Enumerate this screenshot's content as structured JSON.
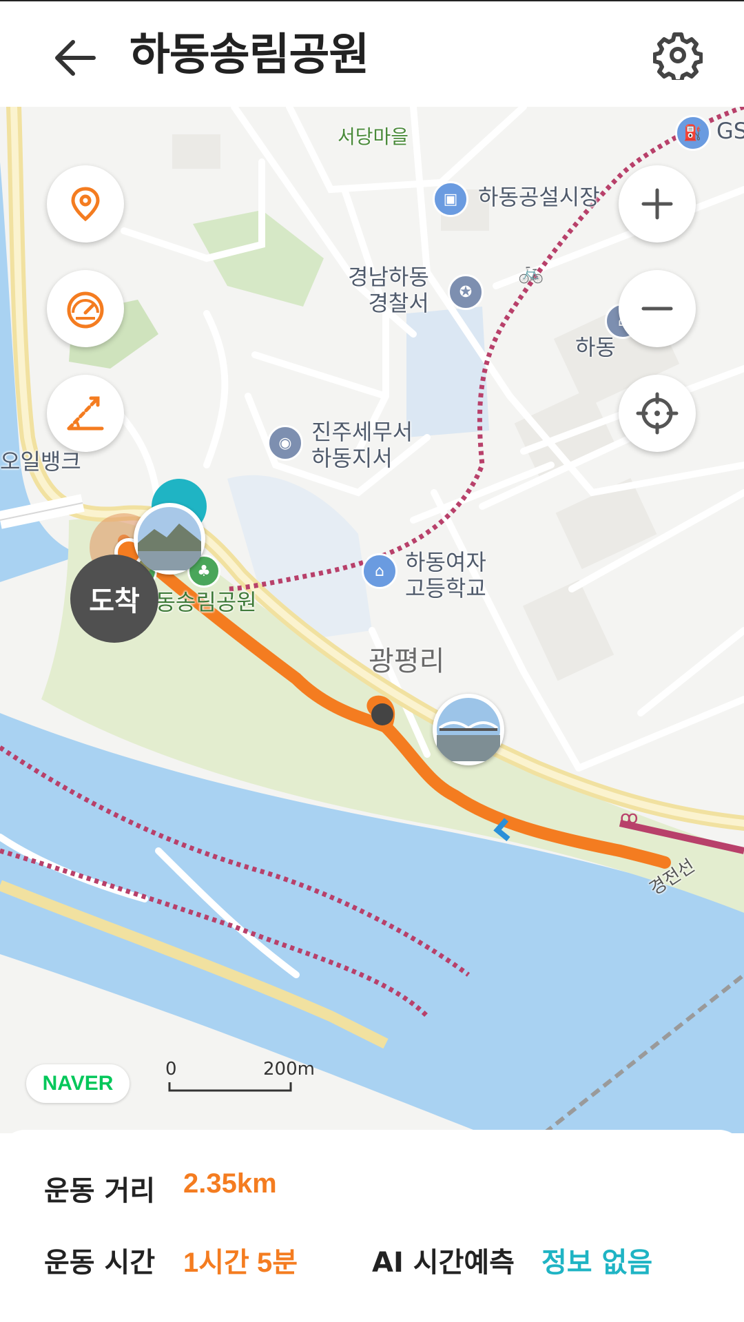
{
  "header": {
    "title": "하동송림공원",
    "back_icon": "arrow-left-icon",
    "settings_icon": "gear-icon"
  },
  "map": {
    "labels": {
      "seodang": "서당마을",
      "market": "하동공설시장",
      "police": "경남하동\n경찰서",
      "tax_office": "진주세무서\n하동지서",
      "girls_school": "하동여자\n고등학교",
      "gwangpyeong": "광평리",
      "park": "하동송림공원",
      "gs": "GS",
      "hadong_partial": "하동",
      "oilbank_partial": "오일뱅크",
      "railway": "경전선"
    },
    "arrive_label": "도착",
    "scale": {
      "start": "0",
      "end": "200m"
    },
    "provider": "NAVER",
    "route_color": "#f47c20",
    "bike_path_color": "#b8406a"
  },
  "controls": {
    "location_pin_icon": "location-pin-icon",
    "speedometer_icon": "speedometer-icon",
    "slope_icon": "slope-icon",
    "zoom_in_icon": "plus-icon",
    "zoom_out_icon": "minus-icon",
    "my_location_icon": "crosshair-icon"
  },
  "stats": {
    "distance_label": "운동 거리",
    "distance_value": "2.35km",
    "time_label": "운동 시간",
    "time_value": "1시간 5분",
    "ai_label": "AI 시간예측",
    "ai_value": "정보 없음"
  },
  "colors": {
    "accent_orange": "#f47c20",
    "teal": "#1fb4c4",
    "water": "#a9d2f2",
    "park_green": "#e3edcf"
  }
}
